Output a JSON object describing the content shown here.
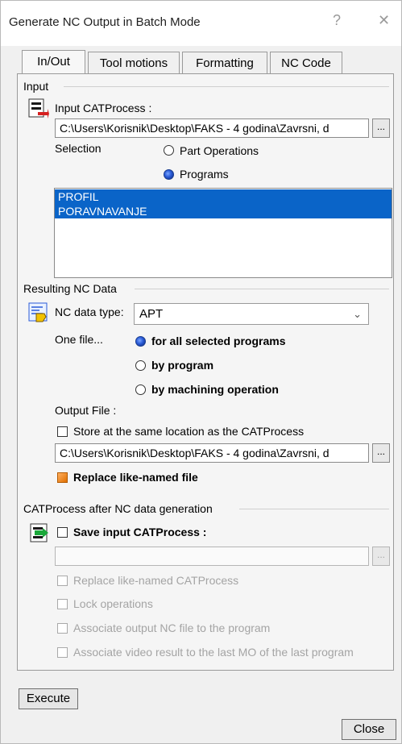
{
  "window": {
    "title": "Generate NC Output in Batch Mode",
    "help": "?",
    "close": "✕"
  },
  "tabs": [
    {
      "label": "In/Out",
      "active": true
    },
    {
      "label": "Tool motions",
      "active": false
    },
    {
      "label": "Formatting",
      "active": false
    },
    {
      "label": "NC Code",
      "active": false
    }
  ],
  "input": {
    "section": "Input",
    "catprocess_label": "Input CATProcess :",
    "catprocess_path": "C:\\Users\\Korisnik\\Desktop\\FAKS - 4 godina\\Zavrsni, d",
    "browse": "...",
    "selection_label": "Selection",
    "opt_part_operations": "Part Operations",
    "opt_programs": "Programs",
    "selected_option": "Programs",
    "programs": [
      "PROFIL",
      "PORAVNAVANJE"
    ]
  },
  "nc_data": {
    "section": "Resulting NC Data",
    "type_label": "NC data type:",
    "type_value": "APT",
    "one_file_label": "One file...",
    "opt_all": "for all selected programs",
    "opt_by_program": "by program",
    "opt_by_operation": "by machining operation",
    "selected_option": "for all selected programs",
    "output_file_label": "Output File :",
    "store_same_label": "Store at the same location as the CATProcess",
    "store_same_checked": false,
    "output_path": "C:\\Users\\Korisnik\\Desktop\\FAKS - 4 godina\\Zavrsni, d",
    "browse": "...",
    "replace_label": "Replace like-named file",
    "replace_checked": true
  },
  "after": {
    "section": "CATProcess after NC data generation",
    "save_label": "Save input CATProcess :",
    "save_checked": false,
    "save_path": "",
    "browse": "...",
    "replace_catprocess": "Replace like-named CATProcess",
    "lock_operations": "Lock operations",
    "associate_output": "Associate output NC file to the program",
    "associate_video": "Associate video result to the last MO of the last program"
  },
  "buttons": {
    "execute": "Execute",
    "close": "Close"
  }
}
